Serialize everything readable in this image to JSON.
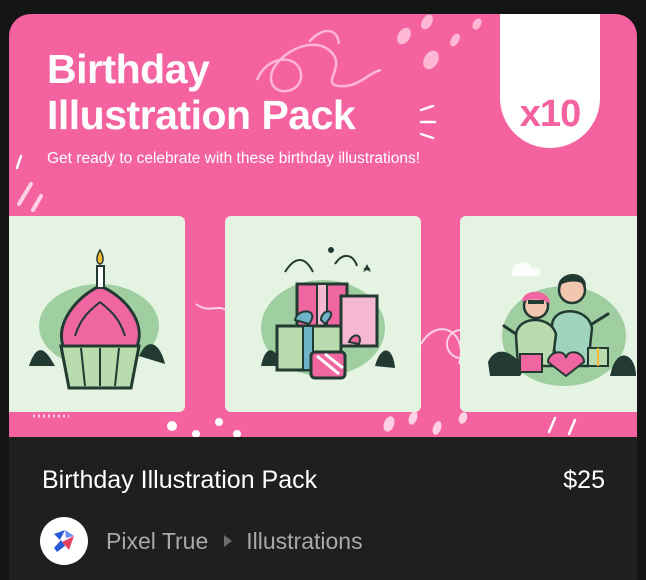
{
  "thumbnail": {
    "title_line1": "Birthday",
    "title_line2": "Illustration Pack",
    "subtitle": "Get ready to celebrate with these birthday illustrations!",
    "badge": "x10",
    "illustrations": [
      "cupcake-illustration",
      "gift-boxes-illustration",
      "couple-celebrating-illustration"
    ]
  },
  "product": {
    "title": "Birthday Illustration Pack",
    "price": "$25",
    "author": "Pixel True",
    "category": "Illustrations"
  },
  "colors": {
    "page_bg": "#141414",
    "card_bg": "#1f1f1f",
    "pink": "#f4629f",
    "panel_green": "#e5f4e2",
    "muted_text": "#a9a9a9"
  }
}
